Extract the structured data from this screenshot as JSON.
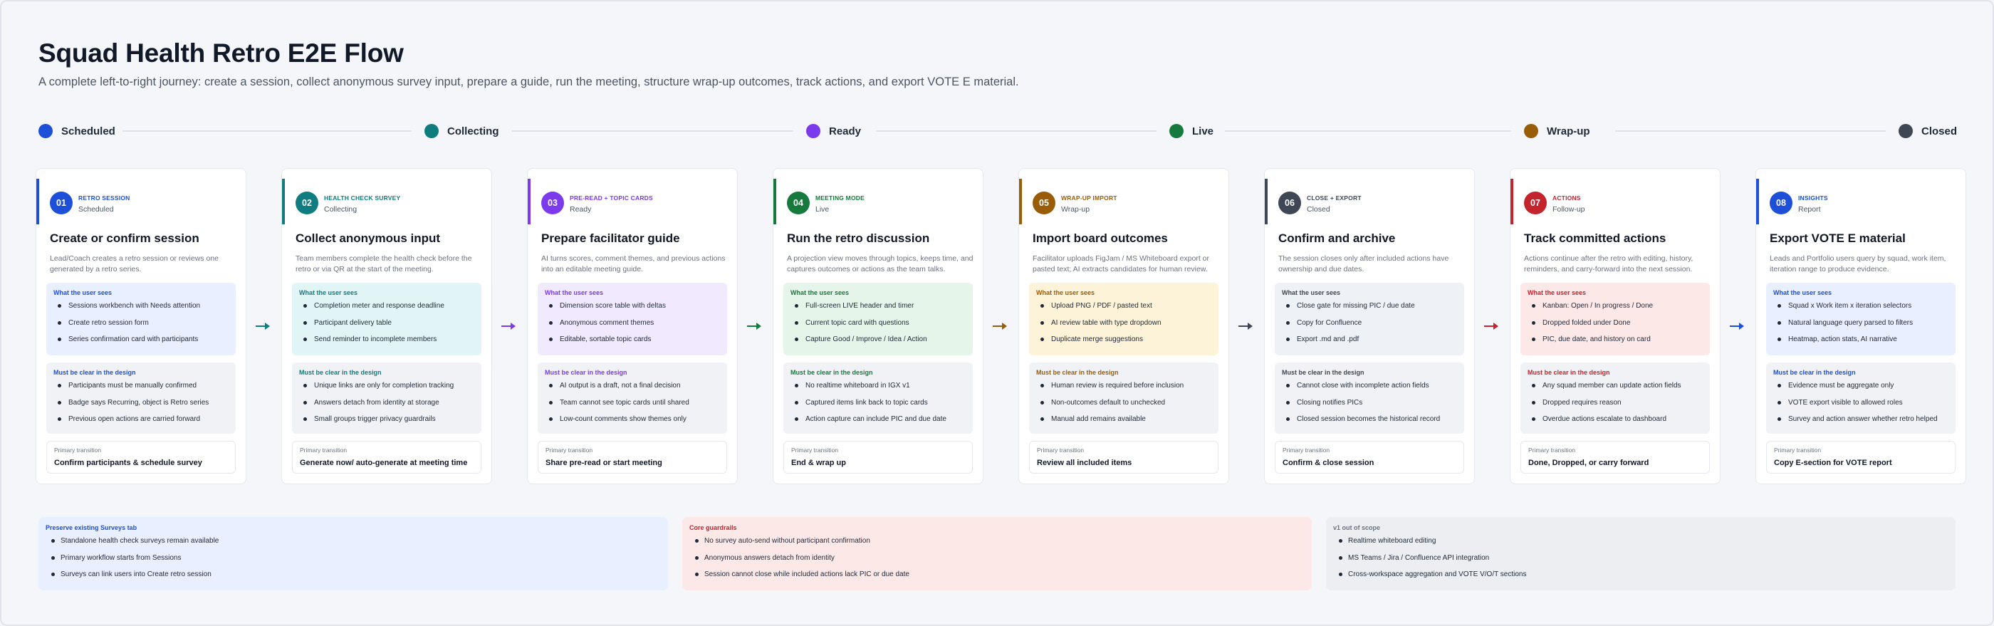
{
  "title": "Squad Health Retro E2E Flow",
  "subtitle": "A complete left-to-right journey: create a session, collect anonymous survey input, prepare a guide, run the meeting, structure wrap-up outcomes, track actions, and export VOTE E material.",
  "statuses": [
    {
      "label": "Scheduled",
      "color": "#1d4fd8"
    },
    {
      "label": "Collecting",
      "color": "#0f7c7f"
    },
    {
      "label": "Ready",
      "color": "#7c3aed"
    },
    {
      "label": "Live",
      "color": "#157a3b"
    },
    {
      "label": "Wrap-up",
      "color": "#9a5d07"
    },
    {
      "label": "Closed",
      "color": "#3f4756"
    }
  ],
  "labels": {
    "sees": "What the user sees",
    "clear": "Must be clear in the design",
    "transition": "Primary transition"
  },
  "cards": [
    {
      "num": "01",
      "kicker": "Retro session",
      "state": "Scheduled",
      "color": "#1d4fd8",
      "tint": "#e8efff",
      "title": "Create or confirm session",
      "desc": "Lead/Coach creates a retro session or reviews one generated by a retro series.",
      "sees": [
        "Sessions workbench with Needs attention",
        "Create retro session form",
        "Series confirmation card with participants"
      ],
      "clear": [
        "Participants must be manually confirmed",
        "Badge says Recurring, object is Retro series",
        "Previous open actions are carried forward"
      ],
      "transition": "Confirm participants & schedule survey"
    },
    {
      "num": "02",
      "kicker": "Health check survey",
      "state": "Collecting",
      "color": "#0f7c7f",
      "tint": "#e2f5f6",
      "title": "Collect anonymous input",
      "desc": "Team members complete the health check before the retro or via QR at the start of the meeting.",
      "sees": [
        "Completion meter and response deadline",
        "Participant delivery table",
        "Send reminder to incomplete members"
      ],
      "clear": [
        "Unique links are only for completion tracking",
        "Answers detach from identity at storage",
        "Small groups trigger privacy guardrails"
      ],
      "transition": "Generate now/ auto-generate at meeting time"
    },
    {
      "num": "03",
      "kicker": "Pre-read + topic cards",
      "state": "Ready",
      "color": "#7c3aed",
      "tint": "#f1eafe",
      "title": "Prepare facilitator guide",
      "desc": "AI turns scores, comment themes, and previous actions into an editable meeting guide.",
      "sees": [
        "Dimension score table with deltas",
        "Anonymous comment themes",
        "Editable, sortable topic cards"
      ],
      "clear": [
        "AI output is a draft, not a final decision",
        "Team cannot see topic cards until shared",
        "Low-count comments show themes only"
      ],
      "transition": "Share pre-read or start meeting"
    },
    {
      "num": "04",
      "kicker": "Meeting mode",
      "state": "Live",
      "color": "#157a3b",
      "tint": "#e5f5ea",
      "title": "Run the retro discussion",
      "desc": "A projection view moves through topics, keeps time, and captures outcomes or actions as the team talks.",
      "sees": [
        "Full-screen LIVE header and timer",
        "Current topic card with questions",
        "Capture Good / Improve / Idea / Action"
      ],
      "clear": [
        "No realtime whiteboard in IGX v1",
        "Captured items link back to topic cards",
        "Action capture can include PIC and due date"
      ],
      "transition": "End & wrap up"
    },
    {
      "num": "05",
      "kicker": "Wrap-up import",
      "state": "Wrap-up",
      "color": "#9a5d07",
      "tint": "#fdf3d9",
      "title": "Import board outcomes",
      "desc": "Facilitator uploads FigJam / MS Whiteboard export or pasted text; AI extracts candidates for human review.",
      "sees": [
        "Upload PNG / PDF / pasted text",
        "AI review table with type dropdown",
        "Duplicate merge suggestions"
      ],
      "clear": [
        "Human review is required before inclusion",
        "Non-outcomes default to unchecked",
        "Manual add remains available"
      ],
      "transition": "Review all included items"
    },
    {
      "num": "06",
      "kicker": "Close + export",
      "state": "Closed",
      "color": "#3f4756",
      "tint": "#eef1f5",
      "title": "Confirm and archive",
      "desc": "The session closes only after included actions have ownership and due dates.",
      "sees": [
        "Close gate for missing PIC / due date",
        "Copy for Confluence",
        "Export .md and .pdf"
      ],
      "clear": [
        "Cannot close with incomplete action fields",
        "Closing notifies PICs",
        "Closed session becomes the historical record"
      ],
      "transition": "Confirm & close session"
    },
    {
      "num": "07",
      "kicker": "Actions",
      "state": "Follow-up",
      "color": "#c4242b",
      "tint": "#fde8e8",
      "title": "Track committed actions",
      "desc": "Actions continue after the retro with editing, history, reminders, and carry-forward into the next session.",
      "sees": [
        "Kanban: Open / In progress / Done",
        "Dropped folded under Done",
        "PIC, due date, and history on card"
      ],
      "clear": [
        "Any squad member can update action fields",
        "Dropped requires reason",
        "Overdue actions escalate to dashboard"
      ],
      "transition": "Done, Dropped, or carry forward"
    },
    {
      "num": "08",
      "kicker": "Insights",
      "state": "Report",
      "color": "#1d4fd8",
      "tint": "#e8efff",
      "title": "Export VOTE E material",
      "desc": "Leads and Portfolio users query by squad, work item, iteration range to produce evidence.",
      "sees": [
        "Squad x Work item x iteration selectors",
        "Natural language query parsed to filters",
        "Heatmap, action stats, AI narrative"
      ],
      "clear": [
        "Evidence must be aggregate only",
        "VOTE export visible to allowed roles",
        "Survey and action answer whether retro helped"
      ],
      "transition": "Copy E-section for VOTE report"
    }
  ],
  "panels": [
    {
      "title": "Preserve existing Surveys tab",
      "color": "#1d4fd8",
      "tint": "#e8efff",
      "items": [
        "Standalone health check surveys remain available",
        "Primary workflow starts from Sessions",
        "Surveys can link users into Create retro session"
      ]
    },
    {
      "title": "Core guardrails",
      "color": "#c4242b",
      "tint": "#fde8e8",
      "items": [
        "No survey auto-send without participant confirmation",
        "Anonymous answers detach from identity",
        "Session cannot close while included actions lack PIC or due date"
      ]
    },
    {
      "title": "v1 out of scope",
      "color": "#6b7280",
      "tint": "#eceef2",
      "items": [
        "Realtime whiteboard editing",
        "MS Teams / Jira / Confluence API integration",
        "Cross-workspace aggregation and VOTE V/O/T sections"
      ]
    }
  ]
}
